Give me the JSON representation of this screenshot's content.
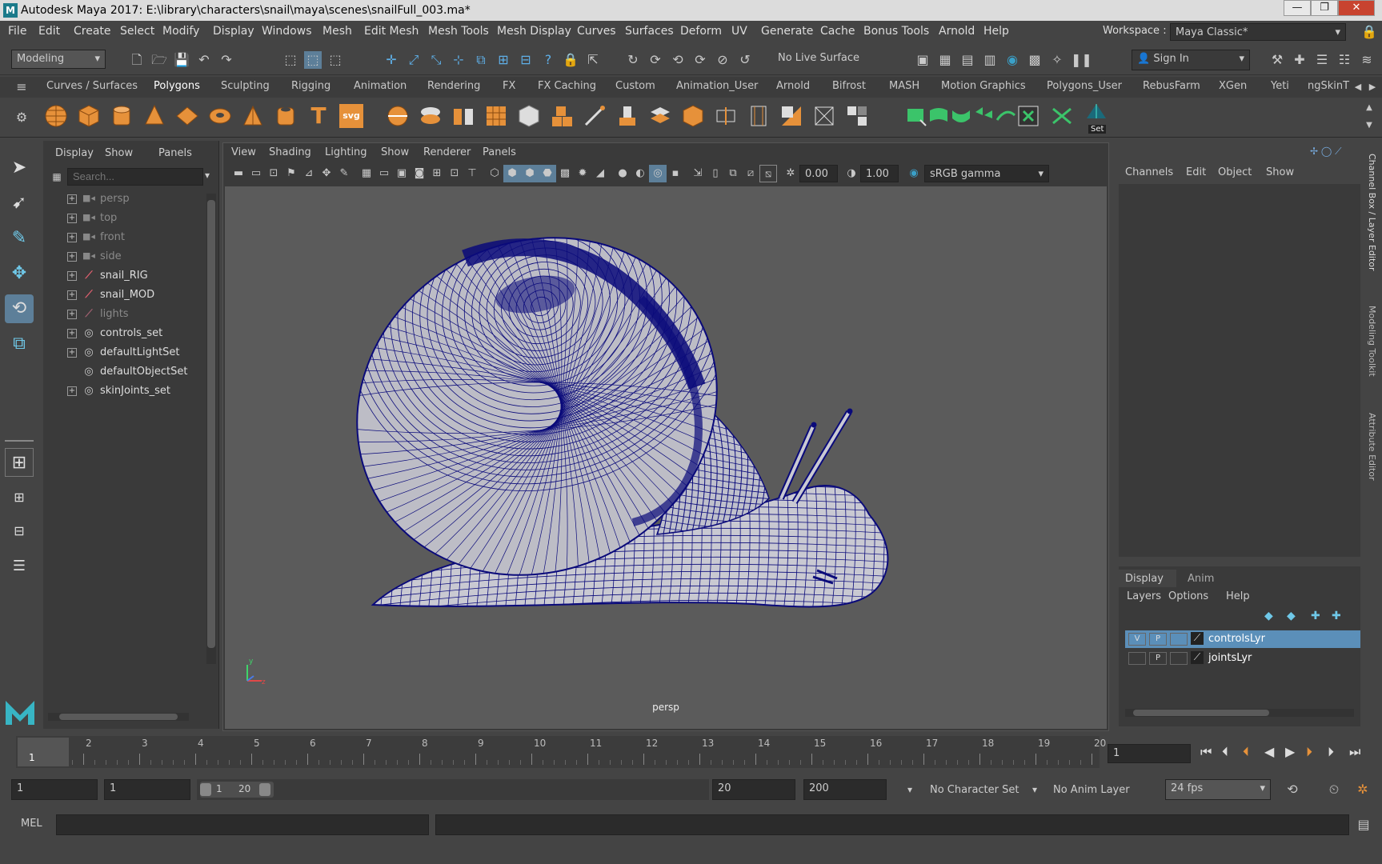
{
  "window": {
    "title": "Autodesk Maya 2017: E:\\library\\characters\\snail\\maya\\scenes\\snailFull_003.ma*",
    "logo": "M"
  },
  "menus": [
    "File",
    "Edit",
    "Create",
    "Select",
    "Modify",
    "Display",
    "Windows",
    "Mesh",
    "Edit Mesh",
    "Mesh Tools",
    "Mesh Display",
    "Curves",
    "Surfaces",
    "Deform",
    "UV",
    "Generate",
    "Cache",
    "Bonus Tools",
    "Arnold",
    "Help"
  ],
  "workspace": {
    "label": "Workspace :",
    "value": "Maya Classic*"
  },
  "status": {
    "mode": "Modeling",
    "live_surface": "No Live Surface",
    "sign_in": "Sign In"
  },
  "shelf_tabs": [
    "Curves / Surfaces",
    "Polygons",
    "Sculpting",
    "Rigging",
    "Animation",
    "Rendering",
    "FX",
    "FX Caching",
    "Custom",
    "Animation_User",
    "Arnold",
    "Bifrost",
    "MASH",
    "Motion Graphics",
    "Polygons_User",
    "RebusFarm",
    "XGen",
    "Yeti",
    "ngSkinT"
  ],
  "shelf_active": "Polygons",
  "shelf_set_label": "Set",
  "outliner": {
    "menu": [
      "Display",
      "Show",
      "Panels"
    ],
    "search_placeholder": "Search...",
    "items": [
      {
        "label": "persp",
        "kind": "camera",
        "dim": true,
        "expand": true
      },
      {
        "label": "top",
        "kind": "camera",
        "dim": true,
        "expand": true
      },
      {
        "label": "front",
        "kind": "camera",
        "dim": true,
        "expand": true
      },
      {
        "label": "side",
        "kind": "camera",
        "dim": true,
        "expand": true
      },
      {
        "label": "snail_RIG",
        "kind": "group",
        "dim": false,
        "expand": true
      },
      {
        "label": "snail_MOD",
        "kind": "group",
        "dim": false,
        "expand": true
      },
      {
        "label": "lights",
        "kind": "group",
        "dim": true,
        "expand": true
      },
      {
        "label": "controls_set",
        "kind": "set",
        "dim": false,
        "expand": true
      },
      {
        "label": "defaultLightSet",
        "kind": "set",
        "dim": false,
        "expand": true
      },
      {
        "label": "defaultObjectSet",
        "kind": "set",
        "dim": false,
        "expand": false
      },
      {
        "label": "skinJoints_set",
        "kind": "set",
        "dim": false,
        "expand": true
      }
    ]
  },
  "viewport": {
    "menu": [
      "View",
      "Shading",
      "Lighting",
      "Show",
      "Renderer",
      "Panels"
    ],
    "exposure": "0.00",
    "gamma": "1.00",
    "colorspace": "sRGB gamma",
    "camera": "persp",
    "mesh_color": "#0a0a7a",
    "bg_color": "#5b5b5b"
  },
  "channel_box": {
    "menu": [
      "Channels",
      "Edit",
      "Object",
      "Show"
    ],
    "layer_tabs": [
      "Display",
      "Anim"
    ],
    "layer_menu": [
      "Layers",
      "Options",
      "Help"
    ],
    "layers": [
      {
        "name": "controlsLyr",
        "v": "V",
        "p": "P",
        "selected": true
      },
      {
        "name": "jointsLyr",
        "v": "",
        "p": "P",
        "selected": false
      }
    ]
  },
  "side_tabs": [
    "Channel Box / Layer Editor",
    "Modeling Toolkit",
    "Attribute Editor"
  ],
  "timeline": {
    "ticks": [
      "1",
      "2",
      "3",
      "4",
      "5",
      "6",
      "7",
      "8",
      "9",
      "10",
      "11",
      "12",
      "13",
      "14",
      "15",
      "16",
      "17",
      "18",
      "19",
      "20"
    ],
    "current_frame": "1",
    "frame_field": "1"
  },
  "range": {
    "start": "1",
    "anim_start": "1",
    "slider_start": "1",
    "slider_end": "20",
    "end": "20",
    "anim_end": "200",
    "character_set": "No Character Set",
    "anim_layer": "No Anim Layer",
    "fps": "24 fps"
  },
  "cmd": {
    "label": "MEL"
  }
}
